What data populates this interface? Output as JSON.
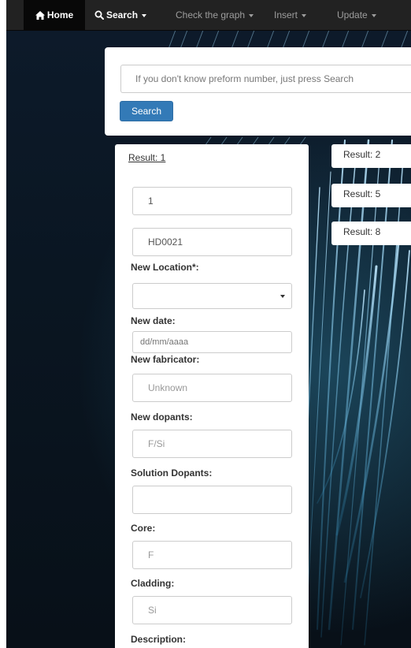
{
  "navbar": {
    "home": "Home",
    "search": "Search",
    "check_graph": "Check the graph",
    "insert": "Insert",
    "update": "Update"
  },
  "search_panel": {
    "placeholder": "If you don't know preform number, just press Search",
    "button": "Search"
  },
  "results": {
    "active_tab": "Result: 1",
    "tabs": [
      "Result: 2",
      "Result: 5",
      "Result: 8"
    ]
  },
  "form": {
    "id_value": "1",
    "preform_value": "HD0021",
    "location_label": "New Location*:",
    "location_selected": "",
    "date_label": "New date:",
    "date_placeholder": "dd/mm/aaaa",
    "fabricator_label": "New fabricator:",
    "fabricator_placeholder": "Unknown",
    "dopants_label": "New dopants:",
    "dopants_placeholder": "F/Si",
    "solution_label": "Solution Dopants:",
    "solution_value": "",
    "core_label": "Core:",
    "core_placeholder": "F",
    "cladding_label": "Cladding:",
    "cladding_placeholder": "Si",
    "description_label": "Description:"
  },
  "colors": {
    "navbar_bg": "#222222",
    "primary_button": "#337ab7"
  },
  "icons": {
    "home": "home-icon",
    "search": "search-icon",
    "dropdown": "caret-down-icon",
    "select": "chevron-down-icon"
  }
}
